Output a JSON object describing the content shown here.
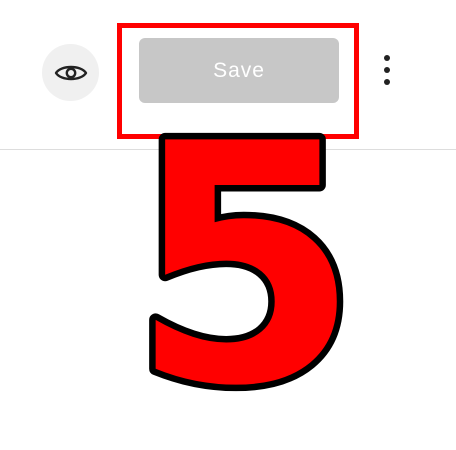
{
  "toolbar": {
    "save_label": "Save",
    "preview_icon": "eye-icon",
    "more_icon": "vertical-dots-icon"
  },
  "overlay": {
    "step_number": "5",
    "highlight_color": "#ff0000",
    "number_fill": "#ff0000",
    "number_outline": "#000000"
  },
  "colors": {
    "save_disabled_bg": "#c7c7c7",
    "preview_bg": "#f0f0f0"
  }
}
